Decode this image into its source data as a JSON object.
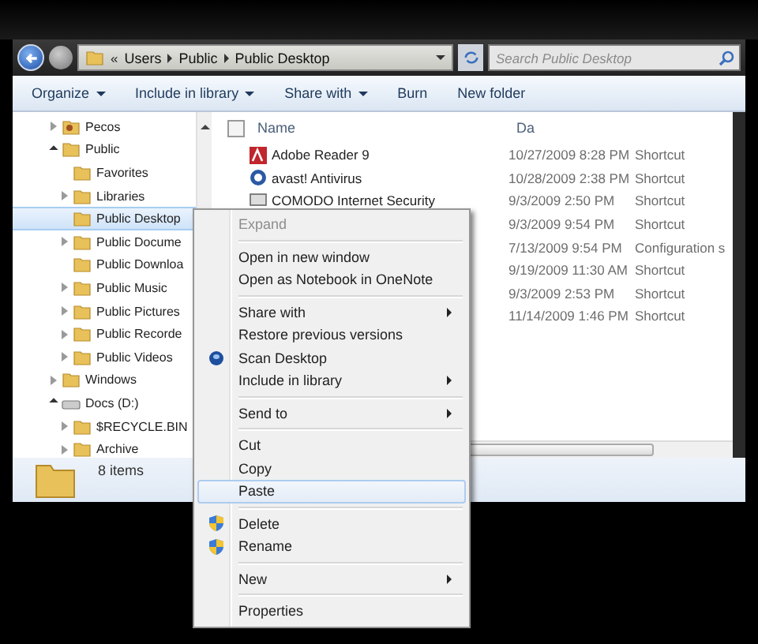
{
  "address": {
    "overflow": "«",
    "crumbs": [
      "Users",
      "Public",
      "Public Desktop"
    ],
    "search_placeholder": "Search Public Desktop"
  },
  "toolbar": [
    {
      "label": "Organize",
      "dropdown": true
    },
    {
      "label": "Include in library",
      "dropdown": true
    },
    {
      "label": "Share with",
      "dropdown": true
    },
    {
      "label": "Burn",
      "dropdown": false
    },
    {
      "label": "New folder",
      "dropdown": false
    }
  ],
  "tree": [
    {
      "label": "Pecos",
      "kind": "user",
      "expandable": true,
      "expanded": false,
      "selected": false
    },
    {
      "label": "Public",
      "kind": "folder",
      "expandable": true,
      "expanded": true,
      "selected": false,
      "children": [
        {
          "label": "Favorites",
          "kind": "folder",
          "expandable": false,
          "expanded": false,
          "selected": false
        },
        {
          "label": "Libraries",
          "kind": "folder",
          "expandable": true,
          "expanded": false,
          "selected": false
        },
        {
          "label": "Public Desktop",
          "kind": "folder",
          "expandable": false,
          "expanded": false,
          "selected": true
        },
        {
          "label": "Public Docume",
          "kind": "folder",
          "expandable": true,
          "expanded": false,
          "selected": false
        },
        {
          "label": "Public Downloa",
          "kind": "folder",
          "expandable": false,
          "expanded": false,
          "selected": false
        },
        {
          "label": "Public Music",
          "kind": "folder",
          "expandable": true,
          "expanded": false,
          "selected": false
        },
        {
          "label": "Public Pictures",
          "kind": "folder",
          "expandable": true,
          "expanded": false,
          "selected": false
        },
        {
          "label": "Public Recorde",
          "kind": "folder",
          "expandable": true,
          "expanded": false,
          "selected": false
        },
        {
          "label": "Public Videos",
          "kind": "folder",
          "expandable": true,
          "expanded": false,
          "selected": false
        }
      ]
    },
    {
      "label": "Windows",
      "kind": "folder",
      "expandable": true,
      "expanded": false,
      "selected": false
    },
    {
      "label": "Docs (D:)",
      "kind": "drive",
      "expandable": true,
      "expanded": true,
      "selected": false,
      "children": [
        {
          "label": "$RECYCLE.BIN",
          "kind": "folder",
          "expandable": true,
          "expanded": false,
          "selected": false
        },
        {
          "label": "Archive",
          "kind": "folder",
          "expandable": true,
          "expanded": false,
          "selected": false
        }
      ]
    }
  ],
  "columns": [
    "Name",
    "Da"
  ],
  "header_checked": false,
  "rows": [
    {
      "name": "Adobe Reader 9",
      "kind": "pdf",
      "date": "10/27/2009 8:28 PM",
      "type": "Shortcut"
    },
    {
      "name": "avast! Antivirus",
      "kind": "avast",
      "date": "10/28/2009 2:38 PM",
      "type": "Shortcut"
    },
    {
      "name": "COMODO Internet Security",
      "kind": "comodo",
      "date": "9/3/2009 2:50 PM",
      "type": "Shortcut"
    },
    {
      "date": "9/3/2009 9:54 PM",
      "type": "Shortcut"
    },
    {
      "date": "7/13/2009 9:54 PM",
      "type": "Configuration s"
    },
    {
      "date": "9/19/2009 11:30 AM",
      "type": "Shortcut"
    },
    {
      "date": "9/3/2009 2:53 PM",
      "type": "Shortcut"
    },
    {
      "date": "11/14/2009 1:46 PM",
      "type": "Shortcut"
    }
  ],
  "status": {
    "count": "8 items"
  },
  "context_menu": [
    {
      "kind": "item",
      "label": "Expand",
      "disabled": true,
      "highlighted": false
    },
    {
      "kind": "separator"
    },
    {
      "kind": "item",
      "label": "Open in new window",
      "disabled": false,
      "highlighted": false
    },
    {
      "kind": "item",
      "label": "Open as Notebook in OneNote",
      "disabled": false,
      "highlighted": false
    },
    {
      "kind": "separator"
    },
    {
      "kind": "item",
      "label": "Share with",
      "submenu": true,
      "disabled": false,
      "highlighted": false
    },
    {
      "kind": "item",
      "label": "Restore previous versions",
      "disabled": false,
      "highlighted": false
    },
    {
      "kind": "scan_item",
      "label": "Scan Desktop",
      "disabled": false,
      "highlighted": false
    },
    {
      "kind": "item",
      "label": "Include in library",
      "submenu": true,
      "disabled": false,
      "highlighted": false
    },
    {
      "kind": "separator"
    },
    {
      "kind": "item",
      "label": "Send to",
      "submenu": true,
      "disabled": false,
      "highlighted": false
    },
    {
      "kind": "separator"
    },
    {
      "kind": "item",
      "label": "Cut",
      "disabled": false,
      "highlighted": false
    },
    {
      "kind": "item",
      "label": "Copy",
      "disabled": false,
      "highlighted": false
    },
    {
      "kind": "item",
      "label": "Paste",
      "disabled": false,
      "highlighted": true
    },
    {
      "kind": "separator"
    },
    {
      "kind": "shield_item",
      "label": "Delete",
      "disabled": false,
      "highlighted": false
    },
    {
      "kind": "shield_item",
      "label": "Rename",
      "disabled": false,
      "highlighted": false
    },
    {
      "kind": "separator"
    },
    {
      "kind": "item",
      "label": "New",
      "submenu": true,
      "disabled": false,
      "highlighted": false
    },
    {
      "kind": "separator"
    },
    {
      "kind": "item",
      "label": "Properties",
      "disabled": false,
      "highlighted": false
    }
  ]
}
